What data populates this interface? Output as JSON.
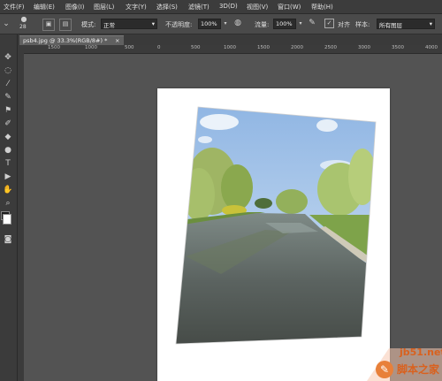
{
  "menu": [
    "文件(F)",
    "编辑(E)",
    "图像(I)",
    "图层(L)",
    "文字(Y)",
    "选择(S)",
    "滤镜(T)",
    "3D(D)",
    "视图(V)",
    "窗口(W)",
    "帮助(H)"
  ],
  "options": {
    "brush_size": "28",
    "mode_label": "模式:",
    "mode_value": "正常",
    "opacity_label": "不透明度:",
    "opacity_value": "100%",
    "flow_label": "流量:",
    "flow_value": "100%",
    "align_label": "对齐",
    "sample_label": "样本:",
    "sample_value": "所有图层"
  },
  "document": {
    "tab_title": "psb4.jpg @ 33.3%(RGB/8#) *",
    "close_glyph": "×"
  },
  "ruler_labels": [
    "1500",
    "1000",
    "500",
    "0",
    "500",
    "1000",
    "1500",
    "2000",
    "2500",
    "3000",
    "3500",
    "4000"
  ],
  "watermark": {
    "site": "jb51.net",
    "brand": "脚本之家"
  },
  "colors": {
    "foreground": "#1a1a1a",
    "background": "#ffffff"
  }
}
